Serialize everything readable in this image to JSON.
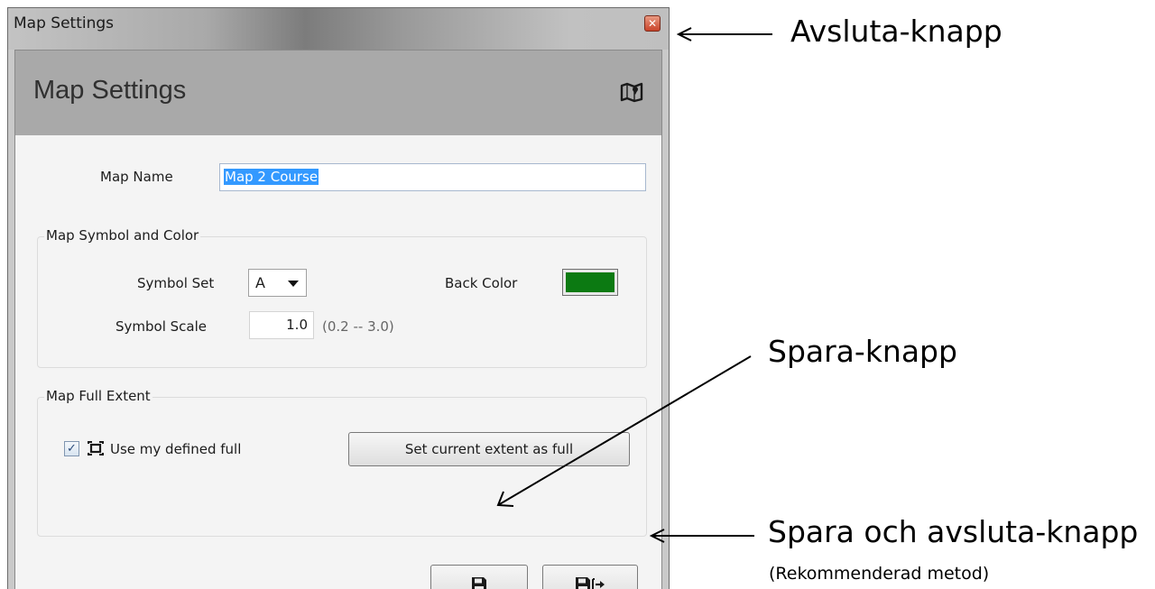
{
  "window": {
    "title": "Map Settings"
  },
  "header": {
    "title": "Map Settings",
    "icon": "map-icon"
  },
  "map_name": {
    "label": "Map Name",
    "value": "Map 2 Course"
  },
  "symbol_group": {
    "title": "Map Symbol and Color",
    "symbol_set_label": "Symbol Set",
    "symbol_set_value": "A",
    "back_color_label": "Back Color",
    "back_color_value": "#0c7a12",
    "symbol_scale_label": "Symbol Scale",
    "symbol_scale_value": "1.0",
    "symbol_scale_range": "(0.2 -- 3.0)"
  },
  "extent_group": {
    "title": "Map Full Extent",
    "use_defined_label": "Use my defined full",
    "use_defined_checked": true,
    "set_current_label": "Set current extent as full"
  },
  "buttons": {
    "save_icon": "floppy-disk-icon",
    "save_exit_icon": "floppy-disk-exit-icon"
  },
  "annotations": {
    "close": "Avsluta-knapp",
    "save": "Spara-knapp",
    "save_exit": "Spara och avsluta-knapp",
    "save_exit_note": "(Rekommenderad metod)"
  }
}
